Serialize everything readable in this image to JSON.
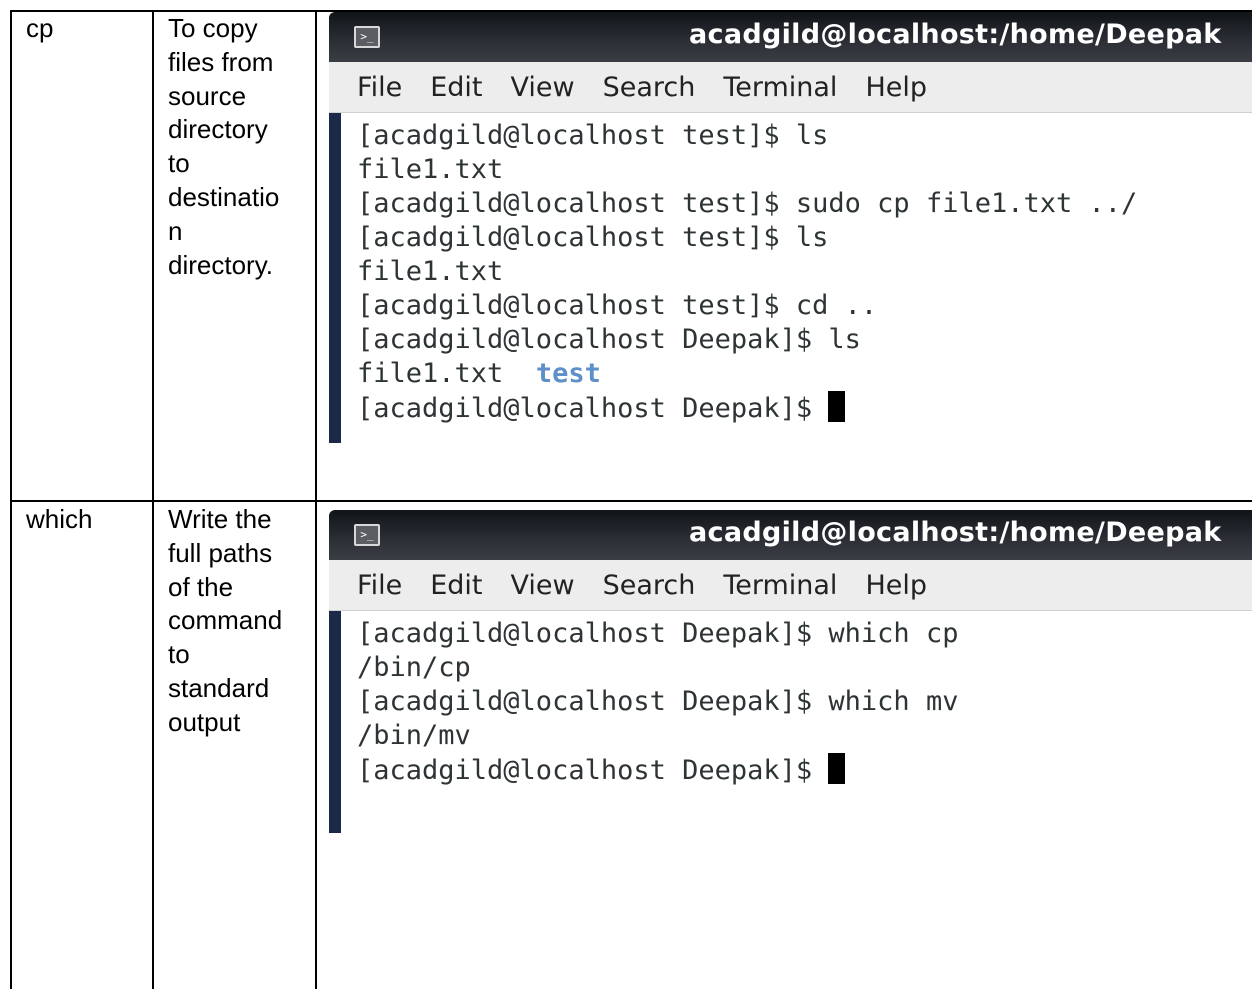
{
  "rows": [
    {
      "command": "cp",
      "description": "To copy\nfiles from\nsource\ndirectory\nto\ndestinatio\nn\ndirectory.",
      "terminal": {
        "title": "acadgild@localhost:/home/Deepak",
        "menu": [
          "File",
          "Edit",
          "View",
          "Search",
          "Terminal",
          "Help"
        ],
        "lines": [
          "[acadgild@localhost test]$ ls",
          "file1.txt",
          "[acadgild@localhost test]$ sudo cp file1.txt ../",
          "[acadgild@localhost test]$ ls",
          "file1.txt",
          "[acadgild@localhost test]$ cd ..",
          "[acadgild@localhost Deepak]$ ls"
        ],
        "listing_file": "file1.txt",
        "listing_dir": "test",
        "prompt": "[acadgild@localhost Deepak]$ "
      }
    },
    {
      "command": "which",
      "description": "Write the\nfull paths\nof the\ncommand\nto\nstandard\noutput",
      "terminal": {
        "title": "acadgild@localhost:/home/Deepak",
        "menu": [
          "File",
          "Edit",
          "View",
          "Search",
          "Terminal",
          "Help"
        ],
        "lines": [
          "[acadgild@localhost Deepak]$ which cp",
          "/bin/cp",
          "[acadgild@localhost Deepak]$ which mv",
          "/bin/mv"
        ],
        "prompt": "[acadgild@localhost Deepak]$ "
      }
    }
  ],
  "icons": {
    "terminal": "terminal-icon"
  }
}
